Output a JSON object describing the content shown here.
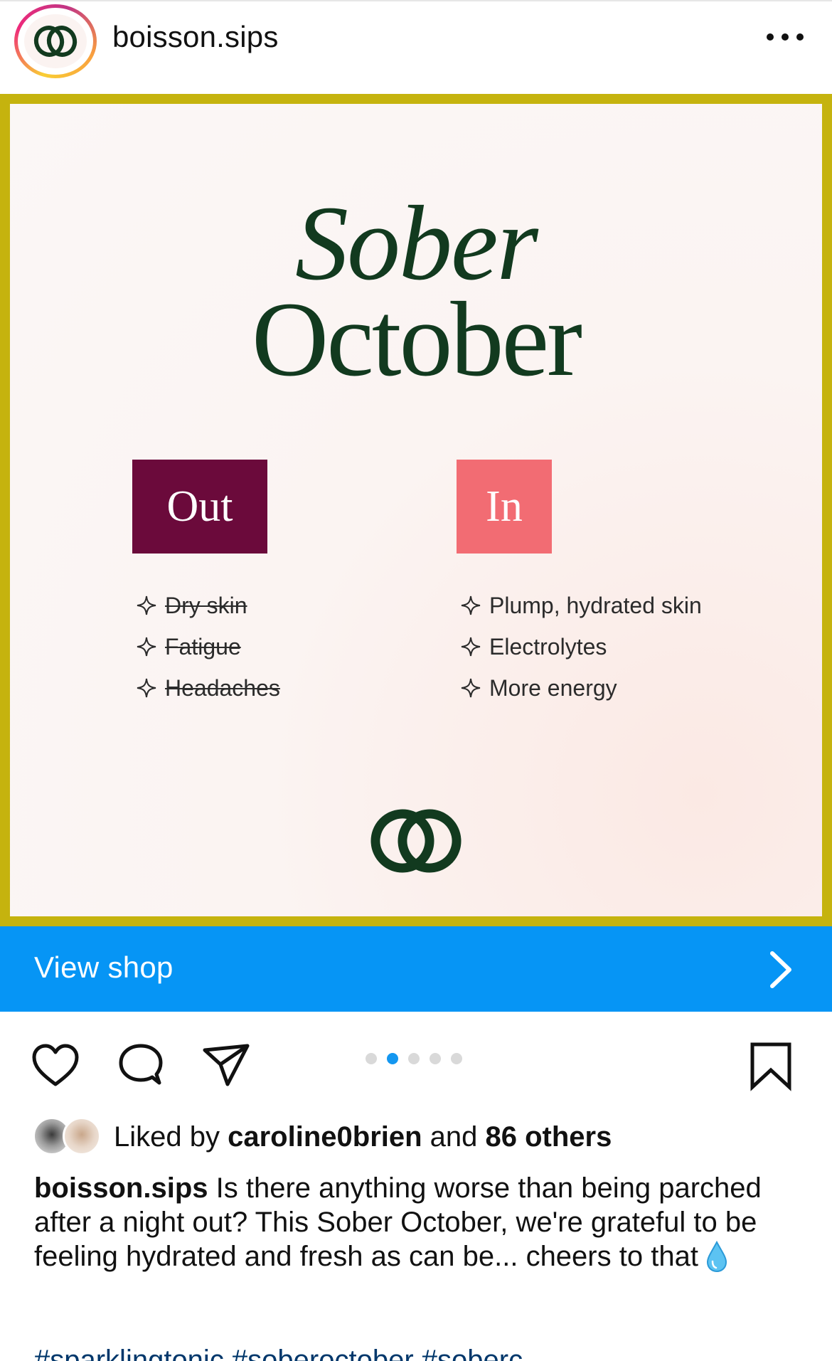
{
  "header": {
    "username": "boisson.sips",
    "more_icon": "more-horizontal-icon"
  },
  "post": {
    "title_line1": "Sober",
    "title_line2": "October",
    "out_label": "Out",
    "in_label": "In",
    "out_items": [
      "Dry skin",
      "Fatigue",
      "Headaches"
    ],
    "in_items": [
      "Plump, hydrated skin",
      "Electrolytes",
      "More energy"
    ],
    "frame_color": "#c5b30e",
    "out_color": "#6b0a3b",
    "in_color": "#f26c73",
    "brand_color": "#123a1f"
  },
  "shop": {
    "label": "View shop",
    "color": "#0695f5"
  },
  "actions": {
    "carousel_count": 5,
    "carousel_active": 2
  },
  "likes": {
    "prefix": "Liked by ",
    "user": "caroline0brien",
    "middle": " and ",
    "others": "86 others"
  },
  "caption": {
    "user": "boisson.sips",
    "text": " Is there anything worse than being parched after a night out? This Sober October, we're grateful to be feeling hydrated and fresh as can be... cheers to that "
  },
  "hashtags": "#sparklingtonic #soberoctober #soberc..."
}
